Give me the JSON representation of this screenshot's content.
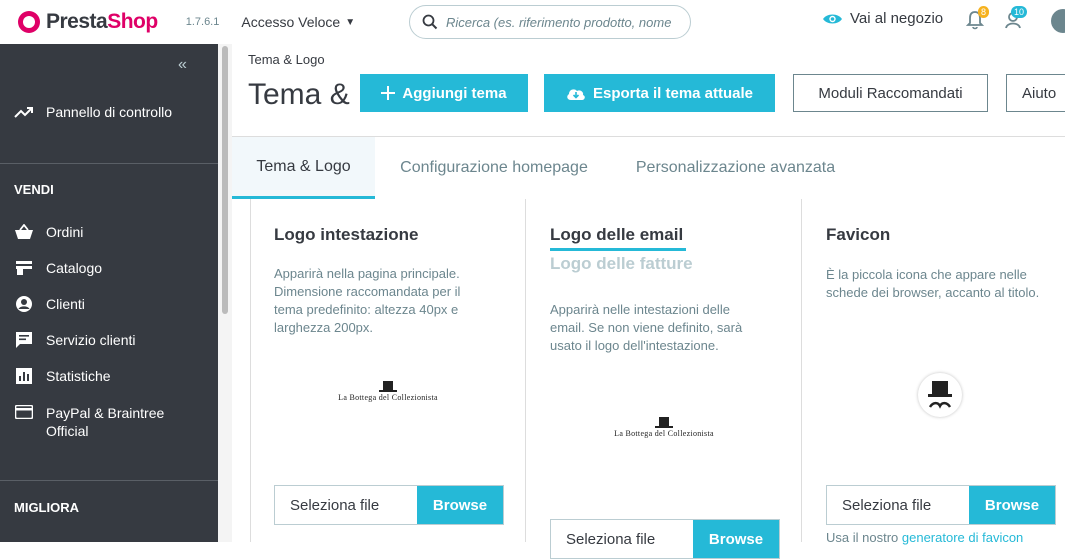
{
  "topbar": {
    "brand_first": "Presta",
    "brand_second": "Shop",
    "version": "1.7.6.1",
    "quick_access": "Accesso Veloce",
    "search_placeholder": "Ricerca (es. riferimento prodotto, nome",
    "shop_link": "Vai al negozio",
    "orders_badge": "8",
    "customers_badge": "10",
    "colors": {
      "accent": "#25b9d7",
      "brand": "#df0067",
      "badge": "#f6b21e"
    }
  },
  "sidebar": {
    "items_top": [
      {
        "label": "Pannello di controllo",
        "icon": "trending-up-icon"
      }
    ],
    "section_sell": "VENDI",
    "items_sell": [
      {
        "label": "Ordini",
        "icon": "basket-icon"
      },
      {
        "label": "Catalogo",
        "icon": "store-icon"
      },
      {
        "label": "Clienti",
        "icon": "account-icon"
      },
      {
        "label": "Servizio clienti",
        "icon": "chat-icon"
      },
      {
        "label": "Statistiche",
        "icon": "bar-chart-icon"
      },
      {
        "label_line1": "PayPal & Braintree",
        "label_line2": "Official",
        "icon": "credit-card-icon"
      }
    ],
    "section_improve": "MIGLIORA",
    "colors": {
      "background": "#363a41"
    }
  },
  "header": {
    "breadcrumb": "Tema & Logo",
    "title": "Tema & Logo",
    "buttons": {
      "add_theme": "Aggiungi tema",
      "export_theme": "Esporta il tema attuale",
      "recommended_modules": "Moduli Raccomandati",
      "help": "Aiuto"
    }
  },
  "tabs": [
    {
      "label": "Tema & Logo",
      "active": true
    },
    {
      "label": "Configurazione homepage",
      "active": false
    },
    {
      "label": "Personalizzazione avanzata",
      "active": false
    }
  ],
  "logos": {
    "header_logo": {
      "title": "Logo intestazione",
      "description": "Apparirà nella pagina principale. Dimensione raccomandata per il tema predefinito: altezza 40px e larghezza 200px.",
      "file_label": "Seleziona file",
      "browse": "Browse"
    },
    "email_logo": {
      "title": "Logo delle email",
      "subtitle": "Logo delle fatture",
      "description": "Apparirà nelle intestazioni delle email. Se non viene definito, sarà usato il logo dell'intestazione.",
      "file_label": "Seleziona file",
      "browse": "Browse"
    },
    "favicon": {
      "title": "Favicon",
      "description": "È la piccola icona che appare nelle schede dei browser, accanto al titolo.",
      "file_label": "Seleziona file",
      "browse": "Browse",
      "note_prefix": "Usa il nostro ",
      "note_link": "generatore di favicon"
    },
    "shop_logo_text": "La Bottega del Collezionista"
  }
}
